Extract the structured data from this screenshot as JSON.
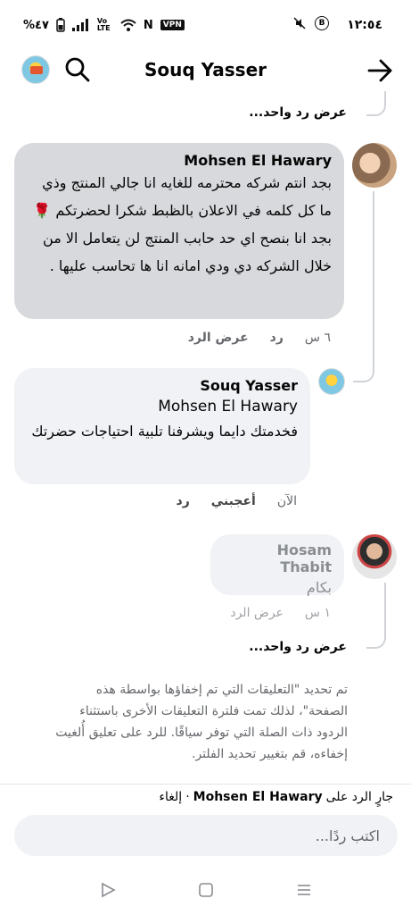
{
  "status": {
    "time": "١٢:٥٤",
    "battery": "%٤٧",
    "vpn": "VPN",
    "nfc": "N",
    "lte": "Vo LTE"
  },
  "header": {
    "title": "Souq Yasser"
  },
  "thread": {
    "view_more_top": "عرض رد واحد...",
    "comment1": {
      "author": "Mohsen El Hawary",
      "text": "بجد انتم شركه محترمه للغايه انا جالي المنتج وذي ما كل كلمه  في الاعلان بالظبط شكرا لحضرتكم 🌹 بجد انا بنصح اي حد حابب المنتج لن يتعامل الا من خلال الشركه دي ودي امانه انا ها تحاسب عليها .",
      "time": "٦ س",
      "reply": "رد",
      "view_reply": "عرض الرد"
    },
    "comment2": {
      "author": "Souq Yasser",
      "mention": "Mohsen El Hawary",
      "text": "فخدمتك دايما ويشرفنا تلبية احتياجات حضرتك",
      "time": "الآن",
      "like": "أعجبني",
      "reply": "رد"
    },
    "comment3": {
      "author": "Hosam Thabit",
      "text": "بكام",
      "time": "١ س",
      "view_reply": "عرض الرد"
    },
    "view_more_bottom": "عرض رد واحد...",
    "notice": "تم تحديد \"التعليقات التي تم إخفاؤها بواسطة هذه الصفحة\"، لذلك تمت فلترة التعليقات الأخرى باستثناء الردود ذات الصلة التي توفر سياقًا. للرد على تعليق أُلغيت إخفاءه، قم بتغيير تحديد الفلتر."
  },
  "composer": {
    "replying_prefix": "جارٍ الرد على",
    "replying_to": "Mohsen El Hawary",
    "separator": "·",
    "cancel": "إلغاء",
    "placeholder": "اكتب ردًا..."
  }
}
